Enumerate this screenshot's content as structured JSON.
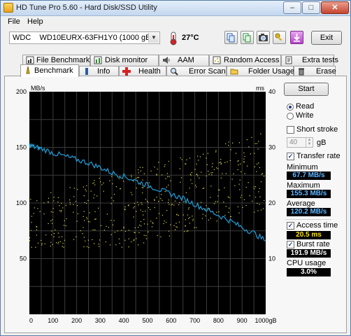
{
  "window": {
    "title": "HD Tune Pro 5.60 - Hard Disk/SSD Utility",
    "min": "–",
    "max": "□",
    "close": "✕"
  },
  "menu": {
    "file": "File",
    "help": "Help"
  },
  "toolbar": {
    "drive": "WDC    WD10EURX-63FH1Y0 (1000 gB)",
    "temperature": "27°C",
    "exit": "Exit",
    "icons": [
      "copy-icon",
      "copy-text-icon",
      "screenshot-camera-icon",
      "keys-icon",
      "download-icon"
    ]
  },
  "tabs_top": [
    "File Benchmark",
    "Disk monitor",
    "AAM",
    "Random Access",
    "Extra tests"
  ],
  "tabs_bottom": [
    "Benchmark",
    "Info",
    "Health",
    "Error Scan",
    "Folder Usage",
    "Erase"
  ],
  "controls": {
    "start": "Start",
    "read": "Read",
    "write": "Write",
    "short_stroke": "Short stroke",
    "short_stroke_value": "40",
    "short_stroke_unit": "gB",
    "transfer_rate": "Transfer rate",
    "minimum_label": "Minimum",
    "minimum": "67.7 MB/s",
    "maximum_label": "Maximum",
    "maximum": "155.3 MB/s",
    "average_label": "Average",
    "average": "120.2 MB/s",
    "access_time": "Access time",
    "access_value": "20.5 ms",
    "burst_rate": "Burst rate",
    "burst_value": "191.9 MB/s",
    "cpu_usage": "CPU usage",
    "cpu_value": "3.0%"
  },
  "colors": {
    "transfer_line": "#1ea0dc",
    "access_points": "#e8e040",
    "plot_bg": "#000000",
    "grid": "#3c3c3c"
  },
  "chart_data": {
    "type": "line",
    "ylabel_left": "MB/s",
    "ylabel_right": "ms",
    "x_ticks": [
      "0",
      "100",
      "200",
      "300",
      "400",
      "500",
      "600",
      "700",
      "800",
      "900",
      "1000gB"
    ],
    "y_ticks_left": [
      "50",
      "100",
      "150",
      "200"
    ],
    "y_ticks_right": [
      "10",
      "20",
      "30",
      "40"
    ],
    "xlim": [
      0,
      1000
    ],
    "ylim_left": [
      0,
      200
    ],
    "ylim_right": [
      0,
      40
    ],
    "grid": true,
    "series": [
      {
        "name": "Transfer rate",
        "x": [
          0,
          25,
          50,
          100,
          150,
          200,
          250,
          300,
          350,
          400,
          450,
          500,
          550,
          600,
          650,
          700,
          750,
          800,
          850,
          900,
          950,
          1000
        ],
        "y": [
          152,
          150,
          149,
          145,
          142,
          139,
          136,
          132,
          127,
          124,
          120,
          116,
          112,
          108,
          104,
          99,
          94,
          89,
          84,
          78,
          73,
          66
        ]
      },
      {
        "name": "Access time",
        "type": "scatter",
        "x_range": [
          0,
          1000
        ],
        "y_range_ms": [
          12,
          36
        ],
        "typical_ms": 20.5
      }
    ]
  }
}
